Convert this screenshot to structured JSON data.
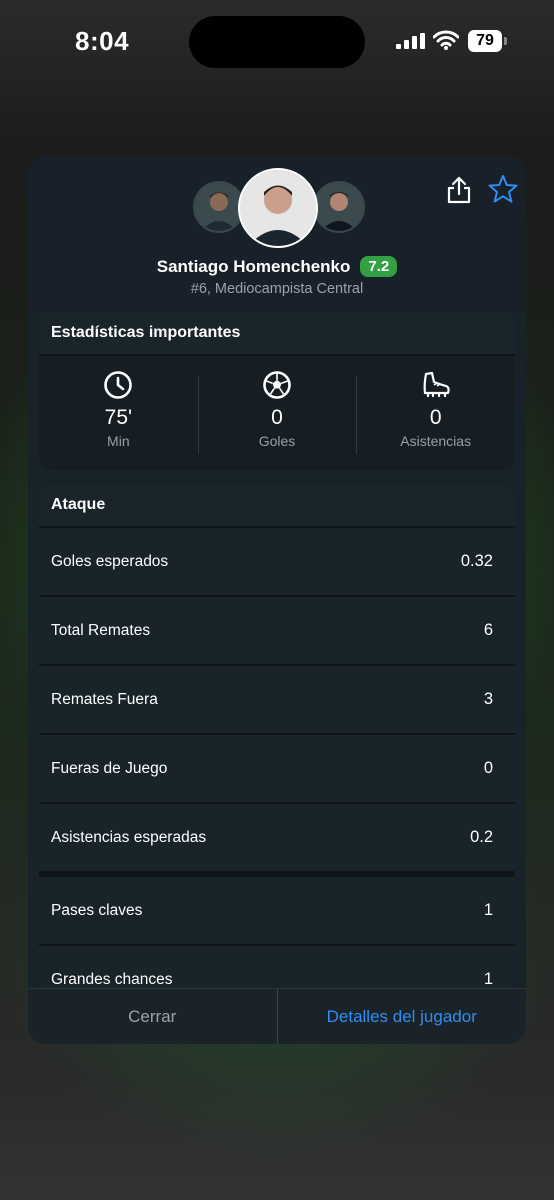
{
  "status_bar": {
    "time": "8:04",
    "battery": "79"
  },
  "player": {
    "name": "Santiago Homenchenko",
    "rating": "7.2",
    "subtitle": "#6, Mediocampista Central"
  },
  "key_stats": {
    "title": "Estadísticas importantes",
    "items": [
      {
        "icon": "clock-icon",
        "value": "75'",
        "label": "Min"
      },
      {
        "icon": "soccer-ball-icon",
        "value": "0",
        "label": "Goles"
      },
      {
        "icon": "boot-icon",
        "value": "0",
        "label": "Asistencias"
      }
    ]
  },
  "attack": {
    "title": "Ataque",
    "rows": [
      {
        "label": "Goles esperados",
        "value": "0.32"
      },
      {
        "label": "Total Remates",
        "value": "6"
      },
      {
        "label": "Remates Fuera",
        "value": "3"
      },
      {
        "label": "Fueras de Juego",
        "value": "0"
      },
      {
        "label": "Asistencias esperadas",
        "value": "0.2"
      },
      {
        "label": "Pases claves",
        "value": "1"
      },
      {
        "label": "Grandes chances",
        "value": "1"
      }
    ]
  },
  "footer": {
    "close_label": "Cerrar",
    "details_label": "Detalles del jugador"
  },
  "colors": {
    "accent": "#2f8ef0",
    "rating_bg": "#33a046"
  }
}
